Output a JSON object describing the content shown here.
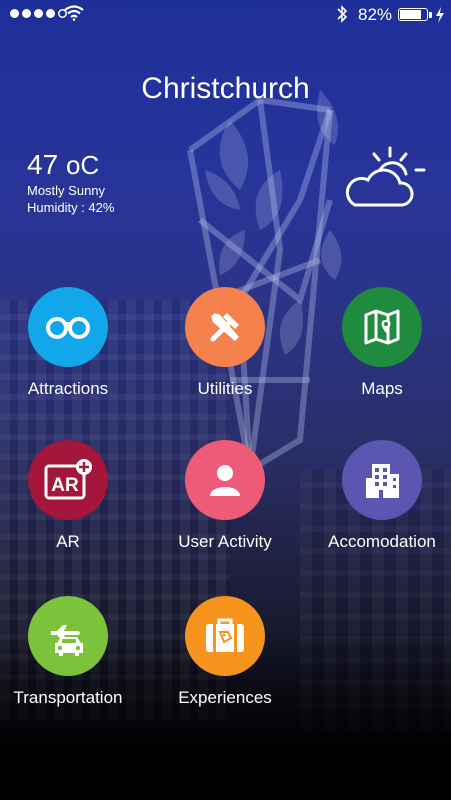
{
  "status_bar": {
    "battery_percent": "82%",
    "battery_level": 0.82,
    "signal_bars": 4,
    "signal_total": 5
  },
  "header": {
    "city": "Christchurch"
  },
  "weather": {
    "temperature": "47",
    "unit": "oC",
    "condition": "Mostly Sunny",
    "humidity": "Humidity : 42%",
    "icon": "partly-cloudy-icon"
  },
  "menu": {
    "attractions": {
      "label": "Attractions",
      "color": "#12a7ea",
      "icon": "binoculars-icon"
    },
    "utilities": {
      "label": "Utilities",
      "color": "#f5814c",
      "icon": "tools-icon"
    },
    "maps": {
      "label": "Maps",
      "color": "#1f8b3f",
      "icon": "map-icon"
    },
    "ar": {
      "label": "AR",
      "color": "#a5173a",
      "icon": "ar-icon"
    },
    "user_activity": {
      "label": "User Activity",
      "color": "#ee5b78",
      "icon": "user-icon"
    },
    "accomodation": {
      "label": "Accomodation",
      "color": "#5a57b2",
      "icon": "building-icon"
    },
    "transportation": {
      "label": "Transportation",
      "color": "#7cc23b",
      "icon": "plane-car-icon"
    },
    "experiences": {
      "label": "Experiences",
      "color": "#f7941d",
      "icon": "suitcase-icon"
    }
  }
}
